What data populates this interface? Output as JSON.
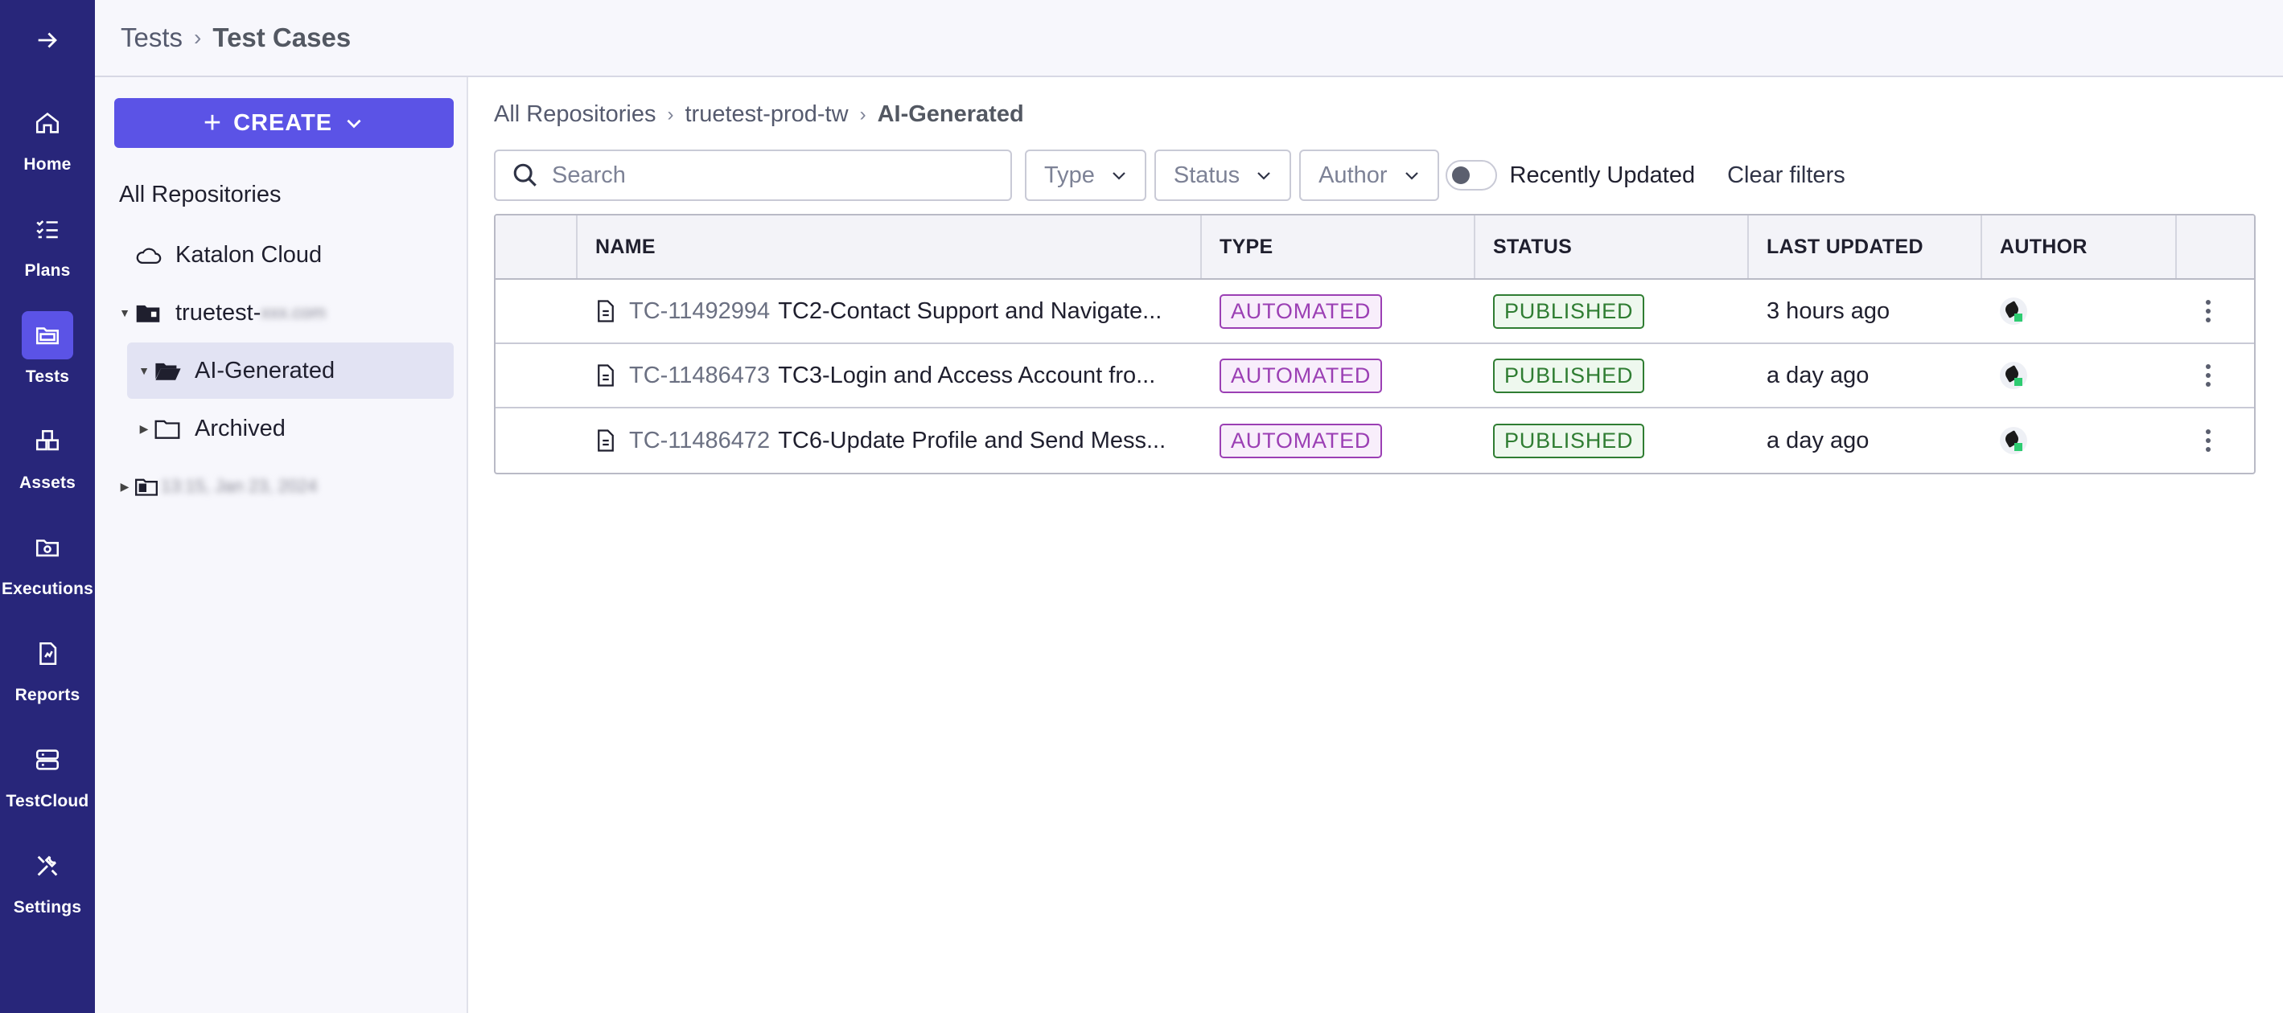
{
  "nav": {
    "items": [
      {
        "label": "Home",
        "icon": "home-icon"
      },
      {
        "label": "Plans",
        "icon": "checklist-icon"
      },
      {
        "label": "Tests",
        "icon": "folder-icon",
        "active": true
      },
      {
        "label": "Assets",
        "icon": "assets-icon"
      },
      {
        "label": "Executions",
        "icon": "executions-icon"
      },
      {
        "label": "Reports",
        "icon": "reports-icon"
      },
      {
        "label": "TestCloud",
        "icon": "server-icon"
      },
      {
        "label": "Settings",
        "icon": "tools-icon"
      }
    ]
  },
  "header": {
    "crumb1": "Tests",
    "crumb2": "Test Cases"
  },
  "tree": {
    "create_label": "CREATE",
    "title": "All Repositories",
    "items": [
      {
        "label": "Katalon Cloud"
      },
      {
        "label": "truetest-",
        "blurred_suffix": "xxx.com"
      },
      {
        "label": "AI-Generated",
        "selected": true
      },
      {
        "label": "Archived"
      },
      {
        "label": "",
        "blurred_suffix": "13:15, Jan 23, 2024"
      }
    ]
  },
  "breadcrumb": {
    "root": "All Repositories",
    "repo": "truetest-prod-tw",
    "current": "AI-Generated"
  },
  "filters": {
    "search_placeholder": "Search",
    "type": "Type",
    "status": "Status",
    "author": "Author",
    "toggle_label": "Recently Updated",
    "clear": "Clear filters"
  },
  "table": {
    "headers": {
      "name": "NAME",
      "type": "TYPE",
      "status": "STATUS",
      "updated": "LAST UPDATED",
      "author": "AUTHOR"
    },
    "rows": [
      {
        "id": "TC-11492994",
        "name": "TC2-Contact Support and Navigate...",
        "type": "AUTOMATED",
        "status": "PUBLISHED",
        "updated": "3 hours ago"
      },
      {
        "id": "TC-11486473",
        "name": "TC3-Login and Access Account fro...",
        "type": "AUTOMATED",
        "status": "PUBLISHED",
        "updated": "a day ago"
      },
      {
        "id": "TC-11486472",
        "name": "TC6-Update Profile and Send Mess...",
        "type": "AUTOMATED",
        "status": "PUBLISHED",
        "updated": "a day ago"
      }
    ]
  },
  "colors": {
    "rail": "#28267a",
    "accent": "#5b53e6",
    "automated": "#9b3fb4",
    "published": "#2f7d32"
  }
}
